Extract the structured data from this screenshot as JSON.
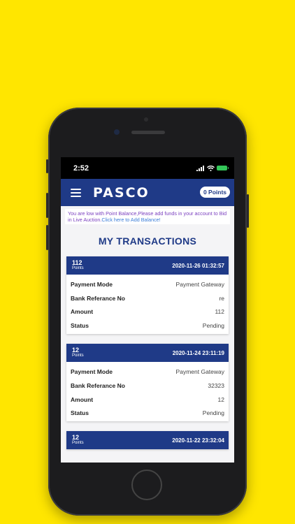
{
  "status_bar": {
    "time": "2:52"
  },
  "header": {
    "logo": "PASCO",
    "points_badge": "0 Points"
  },
  "notice": {
    "part1": "You are low with Point Balance,Please add funds in your account to Bid in Live Auction.",
    "part2": "Click here to Add Balance!"
  },
  "page_title": "MY TRANSACTIONS",
  "labels": {
    "points": "Points",
    "payment_mode": "Payment Mode",
    "bank_ref": "Bank Referance No",
    "amount": "Amount",
    "status": "Status"
  },
  "transactions": [
    {
      "points": "112",
      "date": "2020-11-26 01:32:57",
      "payment_mode": "Payment Gateway",
      "bank_ref": "re",
      "amount": "112",
      "status": "Pending"
    },
    {
      "points": "12",
      "date": "2020-11-24 23:11:19",
      "payment_mode": "Payment Gateway",
      "bank_ref": "32323",
      "amount": "12",
      "status": "Pending"
    },
    {
      "points": "12",
      "date": "2020-11-22 23:32:04"
    }
  ],
  "colors": {
    "background": "#FFE600",
    "brand": "#1f3a87"
  }
}
